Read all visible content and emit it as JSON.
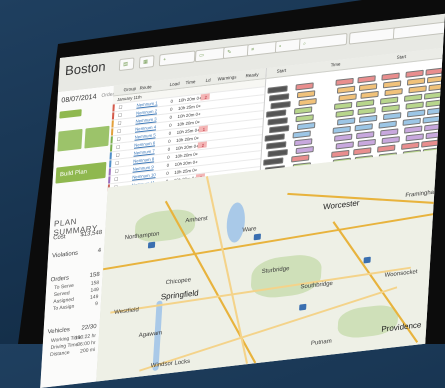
{
  "app": {
    "city": "Boston",
    "date": "08/07/2014",
    "orders_label": "Orders"
  },
  "toolbar": {
    "buttons": [
      "",
      "",
      "",
      "",
      "",
      "",
      ""
    ],
    "search_placeholder": "Search"
  },
  "sidebar": {
    "build_plan": "Build Plan",
    "plan_summary_title": "PLAN SUMMARY",
    "cost_label": "Cost",
    "cost_value": "$13,548",
    "violations_label": "Violations",
    "violations_value": "4",
    "orders_label": "Orders",
    "orders_value": "158",
    "to_serve_label": "To Serve",
    "to_serve_value": "158",
    "served_label": "Served",
    "served_value": "149",
    "assigned_label": "Assigned",
    "assigned_value": "149",
    "to_assign_label": "To Assign",
    "to_assign_value": "9",
    "vehicles_label": "Vehicles",
    "vehicles_value": "22/30",
    "working_time_label": "Working Time",
    "working_time_value": "160:22 hr",
    "driving_time_label": "Driving Time",
    "driving_time_value": "36:00 hr",
    "distance_label": "Distance",
    "distance_value": "200 mi"
  },
  "table": {
    "headers": [
      "Group",
      "Route",
      "Load",
      "Time",
      "Ld",
      "Warnings",
      "Ready"
    ],
    "group_label": "January 11th",
    "rows": [
      {
        "name": "Nemnum 1",
        "load": "0",
        "time": "10h 20m",
        "ld": "0+",
        "warn": "2",
        "color": "#d55a4a"
      },
      {
        "name": "Nemnum 2",
        "load": "0",
        "time": "10h 25m",
        "ld": "0+",
        "warn": "",
        "color": "#d55a4a"
      },
      {
        "name": "Nemnum 3",
        "load": "0",
        "time": "10h 20m",
        "ld": "0+",
        "warn": "",
        "color": "#e3a03a"
      },
      {
        "name": "Nemnum 4",
        "load": "0",
        "time": "10h 20m",
        "ld": "0+",
        "warn": "",
        "color": "#e3a03a"
      },
      {
        "name": "Nemnum 5",
        "load": "0",
        "time": "10h 25m",
        "ld": "0+",
        "warn": "1",
        "color": "#7ab04e"
      },
      {
        "name": "Nemnum 6",
        "load": "0",
        "time": "10h 20m",
        "ld": "0+",
        "warn": "",
        "color": "#7ab04e"
      },
      {
        "name": "Nemnum 7",
        "load": "0",
        "time": "10h 20m",
        "ld": "0+",
        "warn": "2",
        "color": "#4e8ec9"
      },
      {
        "name": "Nemnum 8",
        "load": "0",
        "time": "10h 20m",
        "ld": "0+",
        "warn": "",
        "color": "#4e8ec9"
      },
      {
        "name": "Nemnum 9",
        "load": "0",
        "time": "10h 20m",
        "ld": "0+",
        "warn": "",
        "color": "#9a6bbd"
      },
      {
        "name": "Nemnum 10",
        "load": "0",
        "time": "10h 25m",
        "ld": "0+",
        "warn": "",
        "color": "#9a6bbd"
      },
      {
        "name": "Nemnum 11",
        "load": "0",
        "time": "10h 20m",
        "ld": "0+",
        "warn": "1",
        "color": "#c9655e"
      }
    ]
  },
  "gantt": {
    "header": [
      "Start",
      "Time",
      "Start"
    ],
    "row_colors": [
      "#e98e8e",
      "#f1c27a",
      "#f1c27a",
      "#b8d68c",
      "#b8d68c",
      "#9cc6e6",
      "#9cc6e6",
      "#c8a8de",
      "#c8a8de",
      "#e98e8e",
      "#b8d68c"
    ]
  },
  "map": {
    "towns": [
      {
        "name": "Amherst",
        "size": "sm"
      },
      {
        "name": "Ware",
        "size": "sm"
      },
      {
        "name": "Worcester",
        "size": "lg"
      },
      {
        "name": "Framingham",
        "size": "sm"
      },
      {
        "name": "Springfield",
        "size": "lg"
      },
      {
        "name": "Chicopee",
        "size": "sm"
      },
      {
        "name": "Sturbridge",
        "size": "sm"
      },
      {
        "name": "Westfield",
        "size": "sm"
      },
      {
        "name": "Agawam",
        "size": "sm"
      },
      {
        "name": "Woonsocket",
        "size": "sm"
      },
      {
        "name": "Putnam",
        "size": "sm"
      },
      {
        "name": "Providence",
        "size": "lg"
      },
      {
        "name": "Windsor Locks",
        "size": "sm"
      },
      {
        "name": "Southbridge",
        "size": "sm"
      },
      {
        "name": "Northampton",
        "size": "sm"
      }
    ]
  }
}
